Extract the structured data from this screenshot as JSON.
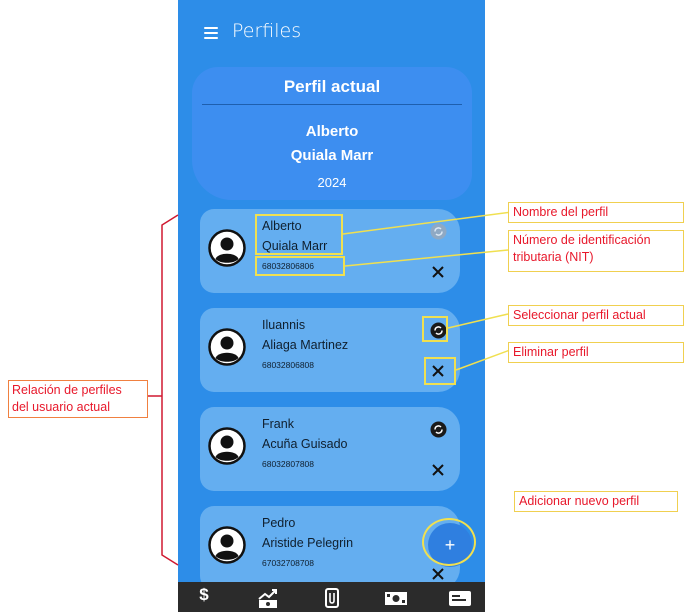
{
  "appbar": {
    "title": "Perfiles"
  },
  "current_profile": {
    "title": "Perfil actual",
    "name_line1": "Alberto",
    "name_line2": "Quiala Marr",
    "year": "2024"
  },
  "profiles": [
    {
      "name_line1": "Alberto",
      "name_line2": "Quiala Marr",
      "nit": "68032806806",
      "is_current": true
    },
    {
      "name_line1": "Iluannis",
      "name_line2": "Aliaga Martinez",
      "nit": "68032806808",
      "is_current": false
    },
    {
      "name_line1": "Frank",
      "name_line2": "Acuña Guisado",
      "nit": "68032807808",
      "is_current": false
    },
    {
      "name_line1": "Pedro",
      "name_line2": "Aristide Pelegrin",
      "nit": "67032708708",
      "is_current": false
    }
  ],
  "fab": {
    "icon": "plus-icon",
    "label": "+"
  },
  "bottom_nav": [
    {
      "icon": "dollar-icon",
      "label": "$"
    },
    {
      "icon": "money-trend-icon"
    },
    {
      "icon": "clip-document-icon"
    },
    {
      "icon": "cash-icon"
    },
    {
      "icon": "id-card-icon"
    }
  ],
  "annotations": {
    "profile_name": "Nombre del perfil",
    "nit_line1": "Número de identificación",
    "nit_line2": "tributaria (NIT)",
    "select_current": "Seleccionar perfil actual",
    "delete_profile": "Eliminar perfil",
    "add_profile": "Adicionar nuevo perfil",
    "relation_line1": "Relación de perfiles",
    "relation_line2": "del usuario actual"
  },
  "colors": {
    "app_blue": "#2d8de8",
    "card_blue": "#64aef0",
    "annotation_red": "#e8182b",
    "annotation_yellow": "#f0e050"
  }
}
